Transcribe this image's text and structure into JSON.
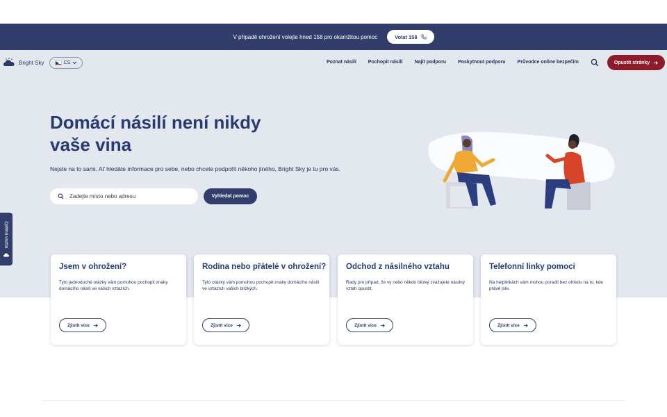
{
  "banner": {
    "text": "V případě ohrožení volejte hned 158 pro okamžitou pomoc",
    "call_label": "Volat 158",
    "call_icon": "phone-icon"
  },
  "header": {
    "logo_text": "Bright Sky",
    "language": "CS",
    "nav": [
      "Poznat násilí",
      "Pochopit násilí",
      "Najít podporu",
      "Poskytnout podporu",
      "Průvodce online bezpečím"
    ],
    "exit_label": "Opustit stránky"
  },
  "hero": {
    "title": "Domácí násilí není nikdy vaše vina",
    "subtitle": "Nejste na to sami. Ať hledáte informace pro sebe, nebo chcete podpořit někoho jiného, Bright Sky je tu pro vás.",
    "search_placeholder": "Zadejte místo nebo adresu",
    "search_button": "Vyhledat pomoc"
  },
  "feedback": {
    "label": "Zpětná vazba"
  },
  "cards": [
    {
      "title": "Jsem v ohrožení?",
      "text": "Tyto jednoduché otázky vám pomohou pochopit znaky domácího násilí ve vašich vztazích.",
      "button": "Zjistit více"
    },
    {
      "title": "Rodina nebo přátelé v ohrožení?",
      "text": "Tyto otázky vám pomohou pochopit znaky domácího násilí ve vztazích vašich blízkých.",
      "button": "Zjistit více"
    },
    {
      "title": "Odchod z násilného vztahu",
      "text": "Rady pro případ, že vy nebo někdo blízký zvažujete násilný vztah opustit.",
      "button": "Zjistit více"
    },
    {
      "title": "Telefonní linky pomoci",
      "text": "Na helplinkách vám mohou poradit bez ohledu na to, kde právě jste.",
      "button": "Zjistit více"
    }
  ],
  "colors": {
    "banner": "#313d6b",
    "hero_bg": "#e3e7ee",
    "exit_button": "#8e1b2a",
    "heading": "#263a73"
  }
}
